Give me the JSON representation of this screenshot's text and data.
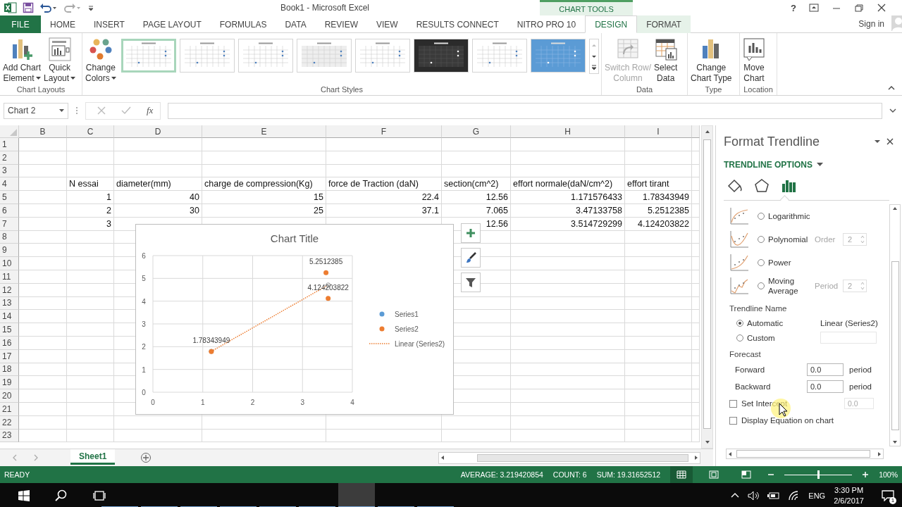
{
  "title_bar": {
    "title": "Book1 - Microsoft Excel",
    "context_label": "CHART TOOLS",
    "help": "?"
  },
  "ribbon_tabs": [
    {
      "label": "FILE",
      "kind": "file",
      "selected": false
    },
    {
      "label": "HOME",
      "kind": "normal",
      "selected": false
    },
    {
      "label": "INSERT",
      "kind": "normal",
      "selected": false
    },
    {
      "label": "PAGE LAYOUT",
      "kind": "normal",
      "selected": false
    },
    {
      "label": "FORMULAS",
      "kind": "normal",
      "selected": false
    },
    {
      "label": "DATA",
      "kind": "normal",
      "selected": false
    },
    {
      "label": "REVIEW",
      "kind": "normal",
      "selected": false
    },
    {
      "label": "VIEW",
      "kind": "normal",
      "selected": false
    },
    {
      "label": "RESULTS CONNECT",
      "kind": "normal",
      "selected": false
    },
    {
      "label": "NITRO PRO 10",
      "kind": "normal",
      "selected": false
    },
    {
      "label": "DESIGN",
      "kind": "context",
      "selected": true
    },
    {
      "label": "FORMAT",
      "kind": "context",
      "selected": false
    }
  ],
  "sign_in": "Sign in",
  "ribbon_groups": [
    {
      "label": "Chart Layouts",
      "buttons": [
        {
          "lines": [
            "Add Chart",
            "Element"
          ],
          "dropdown": true,
          "disabled": false
        },
        {
          "lines": [
            "Quick",
            "Layout"
          ],
          "dropdown": true,
          "disabled": false
        }
      ]
    },
    {
      "label": "Chart Styles",
      "buttons": [
        {
          "lines": [
            "Change",
            "Colors"
          ],
          "dropdown": true,
          "disabled": false
        }
      ],
      "styles": [
        {
          "kind": "light",
          "selected": true
        },
        {
          "kind": "light",
          "selected": false
        },
        {
          "kind": "light",
          "selected": false
        },
        {
          "kind": "shaded",
          "selected": false
        },
        {
          "kind": "light",
          "selected": false
        },
        {
          "kind": "dark",
          "selected": false
        },
        {
          "kind": "light",
          "selected": false
        },
        {
          "kind": "blue",
          "selected": false
        }
      ]
    },
    {
      "label": "Data",
      "buttons": [
        {
          "lines": [
            "Switch Row/",
            "Column"
          ],
          "dropdown": false,
          "disabled": true
        },
        {
          "lines": [
            "Select",
            "Data"
          ],
          "dropdown": false,
          "disabled": false
        }
      ]
    },
    {
      "label": "Type",
      "buttons": [
        {
          "lines": [
            "Change",
            "Chart Type"
          ],
          "dropdown": false,
          "disabled": false
        }
      ]
    },
    {
      "label": "Location",
      "buttons": [
        {
          "lines": [
            "Move",
            "Chart"
          ],
          "dropdown": false,
          "disabled": false
        }
      ]
    }
  ],
  "formula_bar": {
    "name_box": "Chart 2",
    "fx": "fx"
  },
  "sheet": {
    "columns": [
      "B",
      "C",
      "D",
      "E",
      "F",
      "G",
      "H",
      "I"
    ],
    "rows": [
      {
        "num": "1"
      },
      {
        "num": "2"
      },
      {
        "num": "3"
      },
      {
        "num": "4",
        "cells": [
          null,
          {
            "text": "N essai",
            "kind": "text"
          },
          {
            "text": "diameter(mm)",
            "kind": "text"
          },
          {
            "text": "charge de compression(Kg)",
            "kind": "text"
          },
          {
            "text": "force de Traction (daN)",
            "kind": "text"
          },
          {
            "text": "section(cm^2)",
            "kind": "text"
          },
          {
            "text": "effort normale(daN/cm^2)",
            "kind": "text"
          },
          {
            "text": "effort tirant",
            "kind": "text"
          }
        ]
      },
      {
        "num": "5",
        "cells": [
          null,
          {
            "text": "1",
            "kind": "number"
          },
          {
            "text": "40",
            "kind": "number"
          },
          {
            "text": "15",
            "kind": "number"
          },
          {
            "text": "22.4",
            "kind": "number"
          },
          {
            "text": "12.56",
            "kind": "number"
          },
          {
            "text": "1.171576433",
            "kind": "number"
          },
          {
            "text": "1.78343949",
            "kind": "number"
          }
        ]
      },
      {
        "num": "6",
        "cells": [
          null,
          {
            "text": "2",
            "kind": "number"
          },
          {
            "text": "30",
            "kind": "number"
          },
          {
            "text": "25",
            "kind": "number"
          },
          {
            "text": "37.1",
            "kind": "number"
          },
          {
            "text": "7.065",
            "kind": "number"
          },
          {
            "text": "3.47133758",
            "kind": "number"
          },
          {
            "text": "5.2512385",
            "kind": "number"
          }
        ]
      },
      {
        "num": "7",
        "cells": [
          null,
          {
            "text": "3",
            "kind": "number"
          },
          null,
          null,
          null,
          {
            "text": "12.56",
            "kind": "number"
          },
          {
            "text": "3.514729299",
            "kind": "number"
          },
          {
            "text": "4.124203822",
            "kind": "number"
          }
        ]
      },
      {
        "num": "8"
      },
      {
        "num": "9"
      },
      {
        "num": "10"
      },
      {
        "num": "11"
      },
      {
        "num": "12"
      },
      {
        "num": "13"
      },
      {
        "num": "14"
      },
      {
        "num": "15"
      },
      {
        "num": "16"
      },
      {
        "num": "17"
      },
      {
        "num": "18"
      },
      {
        "num": "19"
      },
      {
        "num": "20"
      },
      {
        "num": "21"
      },
      {
        "num": "22"
      },
      {
        "num": "23"
      }
    ]
  },
  "chart": {
    "chart_data": {
      "type": "scatter",
      "title": "Chart Title",
      "x": [
        1.171576433,
        3.47133758,
        3.514729299
      ],
      "series": [
        {
          "name": "Series1",
          "color": "#5b9bd5",
          "values": [
            null,
            null,
            null
          ]
        },
        {
          "name": "Series2",
          "color": "#ed7d31",
          "values": [
            1.78343949,
            5.2512385,
            4.124203822
          ]
        }
      ],
      "xlim": [
        0,
        4
      ],
      "ylim": [
        0,
        6
      ],
      "xticks": [
        0,
        1,
        2,
        3,
        4
      ],
      "yticks": [
        0,
        1,
        2,
        3,
        4,
        5,
        6
      ],
      "data_labels": true,
      "grid": true
    },
    "trendline": {
      "label": "Linear (Series2)",
      "selected": true
    },
    "tools": [
      {
        "kind": "add"
      },
      {
        "kind": "style"
      },
      {
        "kind": "filter"
      }
    ]
  },
  "sheet_tabs": [
    {
      "label": "Sheet1",
      "selected": true
    }
  ],
  "format_pane": {
    "title": "Format Trendline",
    "section": "TRENDLINE OPTIONS",
    "tabs": [
      {
        "kind": "fill",
        "selected": false
      },
      {
        "kind": "effects",
        "selected": false
      },
      {
        "kind": "options",
        "selected": true
      }
    ],
    "types": [
      {
        "kind": "logarithmic",
        "label": "Logarithmic",
        "selected": false
      },
      {
        "kind": "polynomial",
        "label": "Polynomial",
        "selected": false,
        "param": "Order",
        "param_value": "2"
      },
      {
        "kind": "power",
        "label": "Power",
        "selected": false
      },
      {
        "kind": "moving-average",
        "label": "Moving Average",
        "selected": false,
        "param": "Period",
        "param_value": "2"
      }
    ],
    "name_heading": "Trendline Name",
    "name_options": [
      {
        "label": "Automatic",
        "selected": true,
        "value": "Linear (Series2)"
      },
      {
        "label": "Custom",
        "selected": false
      }
    ],
    "forecast_heading": "Forecast",
    "forecast": [
      {
        "label": "Forward",
        "value": "0.0",
        "unit": "period"
      },
      {
        "label": "Backward",
        "value": "0.0",
        "unit": "period"
      }
    ],
    "checks": [
      {
        "label": "Set Intercept",
        "checked": false,
        "value": "0.0",
        "value_disabled": true
      },
      {
        "label": "Display Equation on chart",
        "checked": false
      }
    ]
  },
  "status_bar": {
    "mode": "READY",
    "stats": [
      "AVERAGE: 3.219420854",
      "COUNT: 6",
      "SUM: 19.31652512"
    ],
    "views": [
      {
        "kind": "normal",
        "selected": true
      },
      {
        "kind": "page-layout",
        "selected": false
      },
      {
        "kind": "page-break",
        "selected": false
      }
    ],
    "zoom": {
      "level": 0.5,
      "label": "100%"
    }
  },
  "taskbar": {
    "apps": [
      {
        "selected": false
      },
      {
        "selected": false
      },
      {
        "selected": false
      },
      {
        "selected": false
      },
      {
        "selected": false
      },
      {
        "selected": false
      },
      {
        "selected": true
      },
      {
        "selected": false
      },
      {
        "selected": false
      }
    ],
    "language": "ENG",
    "time": "3:30 PM",
    "date": "2/6/2017",
    "notifications": "1"
  }
}
